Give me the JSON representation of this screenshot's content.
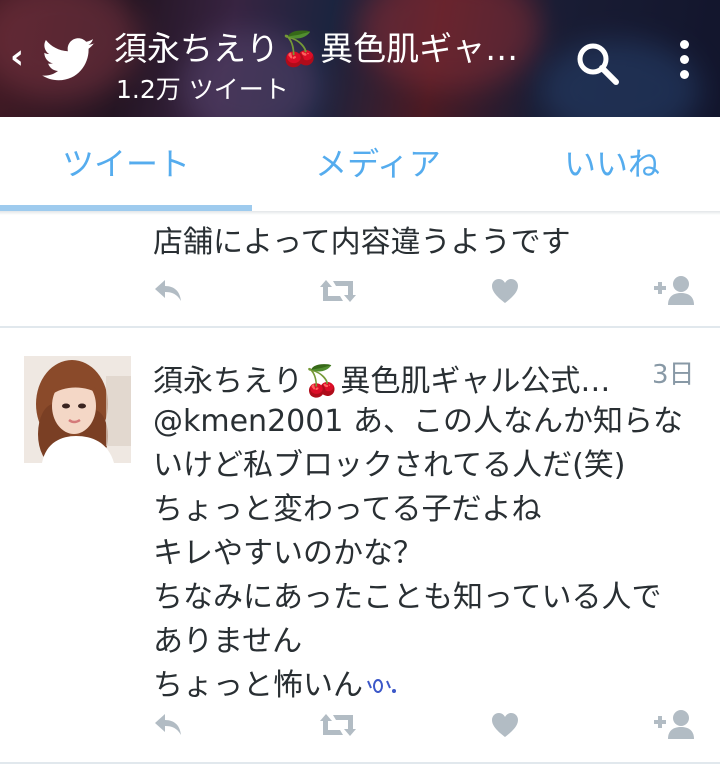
{
  "header": {
    "title": "須永ちえり🍒異色肌ギャル公式アカウント",
    "subtitle": "1.2万 ツイート",
    "icons": [
      "back-chevron-icon",
      "twitter-bird-icon",
      "search-icon",
      "more-vertical-icon"
    ]
  },
  "tabs": [
    {
      "label": "ツイート",
      "selected": true
    },
    {
      "label": "メディア",
      "selected": false
    },
    {
      "label": "いいね",
      "selected": false
    }
  ],
  "accent_color": "#55acee",
  "tweets": [
    {
      "lines": [
        "店舗によって内容違うようです"
      ],
      "actions": [
        "reply-icon",
        "retweet-icon",
        "like-icon",
        "follow-icon"
      ]
    },
    {
      "name": "須永ちえり🍒異色肌ギャル公式…",
      "time": "3日",
      "lines": [
        "@kmen2001 あ、この人なんか知らな",
        "いけど私ブロックされてる人だ(笑)",
        "ちょっと変わってる子だよね",
        "キレやすいのかな？",
        "ちなみにあったことも知っている人で",
        "ありません",
        "ちょっと怖いん"
      ],
      "actions": [
        "reply-icon",
        "retweet-icon",
        "like-icon",
        "follow-icon"
      ]
    }
  ]
}
